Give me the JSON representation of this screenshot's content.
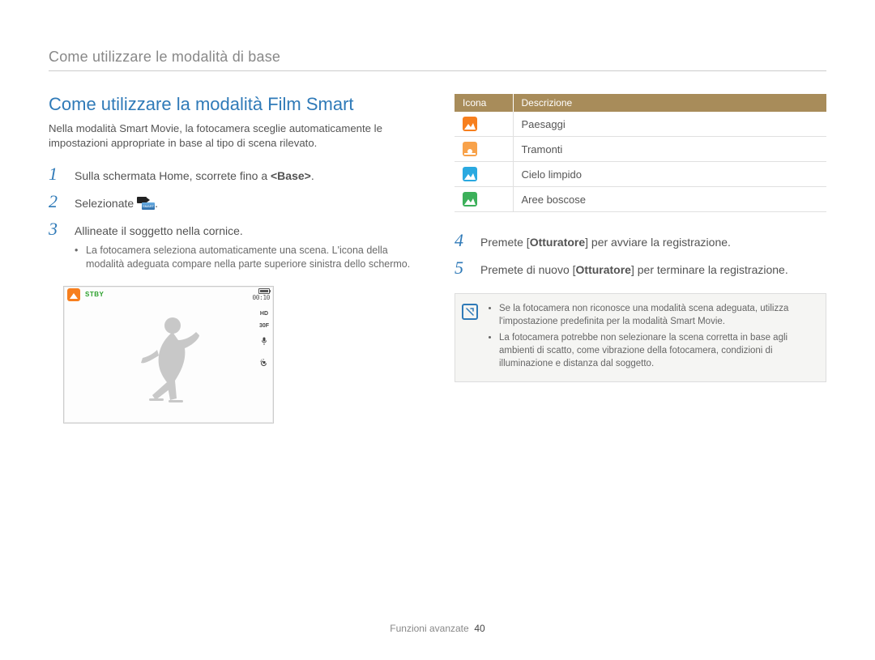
{
  "header": "Come utilizzare le modalità di base",
  "title": "Come utilizzare la modalità Film Smart",
  "intro": "Nella modalità Smart Movie, la fotocamera sceglie automaticamente le impostazioni appropriate in base al tipo di scena rilevato.",
  "steps": {
    "s1": {
      "num": "1",
      "pre": "Sulla schermata Home, scorrete fino a ",
      "bold": "<Base>",
      "post": "."
    },
    "s2": {
      "num": "2",
      "text": "Selezionate ",
      "icon_label": "smart-movie-icon",
      "post": "."
    },
    "s3": {
      "num": "3",
      "text": "Allineate il soggetto nella cornice.",
      "sub": "La fotocamera seleziona automaticamente una scena. L'icona della modalità adeguata compare nella parte superiore sinistra dello schermo."
    },
    "s4": {
      "num": "4",
      "pre": "Premete [",
      "bold": "Otturatore",
      "post": "] per avviare la registrazione."
    },
    "s5": {
      "num": "5",
      "pre": "Premete di nuovo [",
      "bold": "Otturatore",
      "post": "] per terminare la registrazione."
    }
  },
  "preview": {
    "stby": "STBY",
    "time": "00:10",
    "hd": "HD",
    "fps": "30F"
  },
  "table": {
    "head_icon": "Icona",
    "head_desc": "Descrizione",
    "rows": [
      {
        "name": "landscape",
        "desc": "Paesaggi",
        "color": "si-orange"
      },
      {
        "name": "sunset",
        "desc": "Tramonti",
        "color": "si-amber"
      },
      {
        "name": "sky",
        "desc": "Cielo limpido",
        "color": "si-blue"
      },
      {
        "name": "forest",
        "desc": "Aree boscose",
        "color": "si-green"
      }
    ]
  },
  "notes": [
    "Se la fotocamera non riconosce una modalità scena adeguata, utilizza l'impostazione predefinita per la modalità Smart Movie.",
    "La fotocamera potrebbe non selezionare la scena corretta in base agli ambienti di scatto, come vibrazione della fotocamera, condizioni di illuminazione e distanza dal soggetto."
  ],
  "footer": {
    "section": "Funzioni avanzate",
    "page": "40"
  }
}
